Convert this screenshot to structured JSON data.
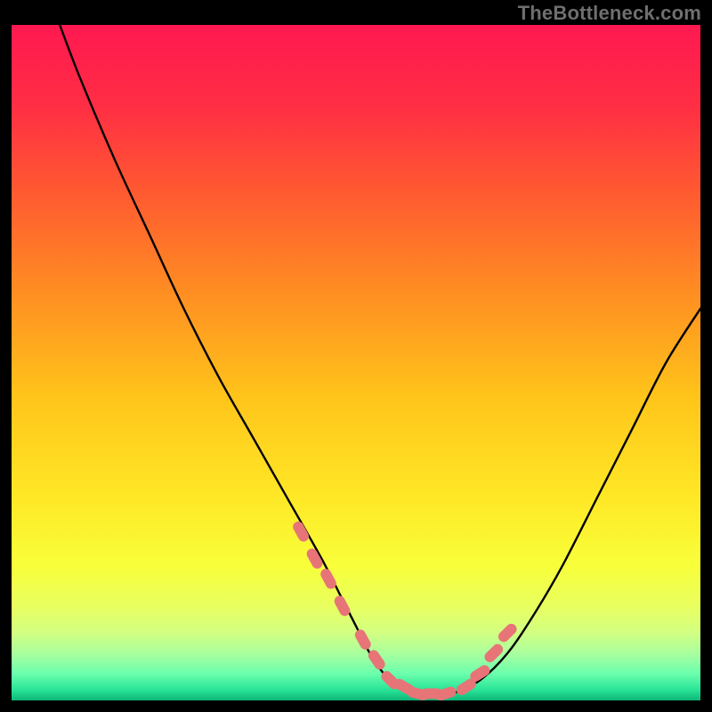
{
  "watermark": "TheBottleneck.com",
  "colors": {
    "frame": "#000000",
    "curve": "#000000",
    "marker": "#e77477",
    "gradient_stops": [
      {
        "offset": 0.0,
        "color": "#ff1850"
      },
      {
        "offset": 0.12,
        "color": "#ff2e44"
      },
      {
        "offset": 0.25,
        "color": "#ff5a30"
      },
      {
        "offset": 0.4,
        "color": "#ff8f22"
      },
      {
        "offset": 0.55,
        "color": "#ffc41a"
      },
      {
        "offset": 0.7,
        "color": "#ffe826"
      },
      {
        "offset": 0.8,
        "color": "#f8ff3a"
      },
      {
        "offset": 0.86,
        "color": "#e9ff5f"
      },
      {
        "offset": 0.9,
        "color": "#d2ff82"
      },
      {
        "offset": 0.93,
        "color": "#aaff9e"
      },
      {
        "offset": 0.96,
        "color": "#6cffad"
      },
      {
        "offset": 0.985,
        "color": "#27e396"
      },
      {
        "offset": 1.0,
        "color": "#0fb577"
      }
    ]
  },
  "chart_data": {
    "type": "line",
    "title": "",
    "xlabel": "",
    "ylabel": "",
    "xlim": [
      0,
      100
    ],
    "ylim": [
      0,
      100
    ],
    "grid": false,
    "legend": null,
    "series": [
      {
        "name": "bottleneck-curve",
        "x": [
          7,
          10,
          15,
          20,
          25,
          30,
          35,
          40,
          45,
          48,
          50,
          52,
          54,
          56,
          58,
          60,
          62,
          64,
          68,
          72,
          76,
          80,
          85,
          90,
          95,
          100
        ],
        "y": [
          100,
          92,
          80,
          69,
          58,
          48,
          39,
          30,
          21,
          15,
          11,
          7,
          4,
          2,
          1,
          0.5,
          0.5,
          1,
          3,
          7,
          13,
          20,
          30,
          40,
          50,
          58
        ]
      }
    ],
    "markers": {
      "name": "highlighted-points",
      "x": [
        42,
        44,
        46,
        48,
        51,
        53,
        55,
        57,
        59,
        61,
        63,
        66,
        68,
        70,
        72
      ],
      "y": [
        25,
        21,
        18,
        14,
        9,
        6,
        3,
        2,
        1,
        1,
        1,
        2,
        4,
        7,
        10
      ]
    }
  }
}
